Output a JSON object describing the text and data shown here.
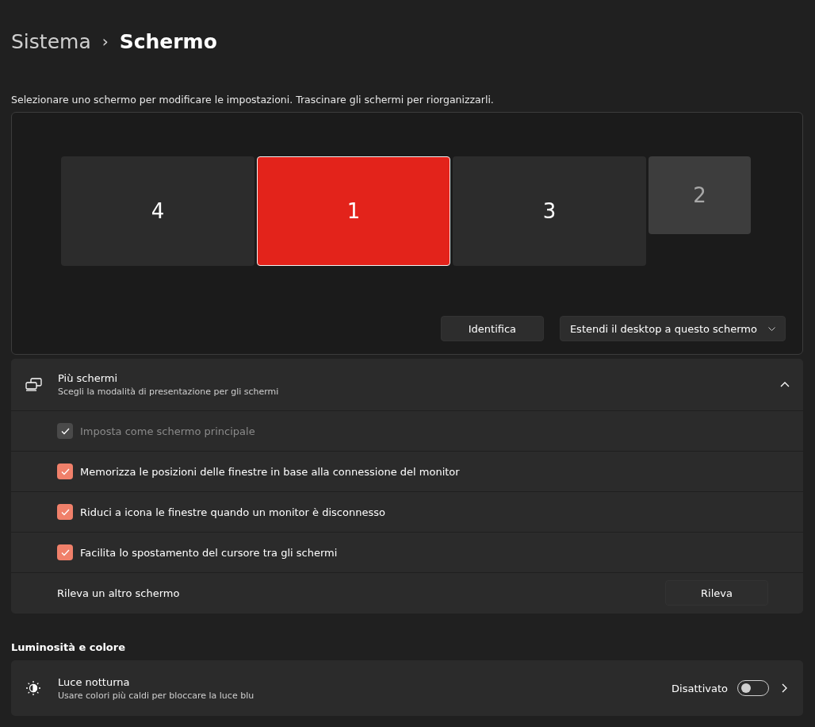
{
  "breadcrumb": {
    "parent": "Sistema",
    "separator": "›",
    "current": "Schermo"
  },
  "arrange_hint": "Selezionare uno schermo per modificare le impostazioni. Trascinare gli schermi per riorganizzarli.",
  "displays": [
    {
      "label": "4",
      "selected": false,
      "kind": "large"
    },
    {
      "label": "1",
      "selected": true,
      "kind": "large"
    },
    {
      "label": "3",
      "selected": false,
      "kind": "large"
    },
    {
      "label": "2",
      "selected": false,
      "kind": "small"
    }
  ],
  "identify_button": "Identifica",
  "mode_dropdown": {
    "value": "Estendi il desktop a questo schermo"
  },
  "multiple_displays": {
    "title": "Più schermi",
    "subtitle": "Scegli la modalità di presentazione per gli schermi",
    "expanded": true,
    "options": [
      {
        "label": "Imposta come schermo principale",
        "checked": true,
        "disabled": true
      },
      {
        "label": "Memorizza le posizioni delle finestre in base alla connessione del monitor",
        "checked": true,
        "disabled": false
      },
      {
        "label": "Riduci a icona le finestre quando un monitor è disconnesso",
        "checked": true,
        "disabled": false
      },
      {
        "label": "Facilita lo spostamento del cursore tra gli schermi",
        "checked": true,
        "disabled": false
      }
    ],
    "detect": {
      "label": "Rileva un altro schermo",
      "button": "Rileva"
    }
  },
  "brightness_section": {
    "heading": "Luminosità e colore",
    "night_light": {
      "title": "Luce notturna",
      "subtitle": "Usare colori più caldi per bloccare la luce blu",
      "status": "Disattivato",
      "on": false
    }
  }
}
